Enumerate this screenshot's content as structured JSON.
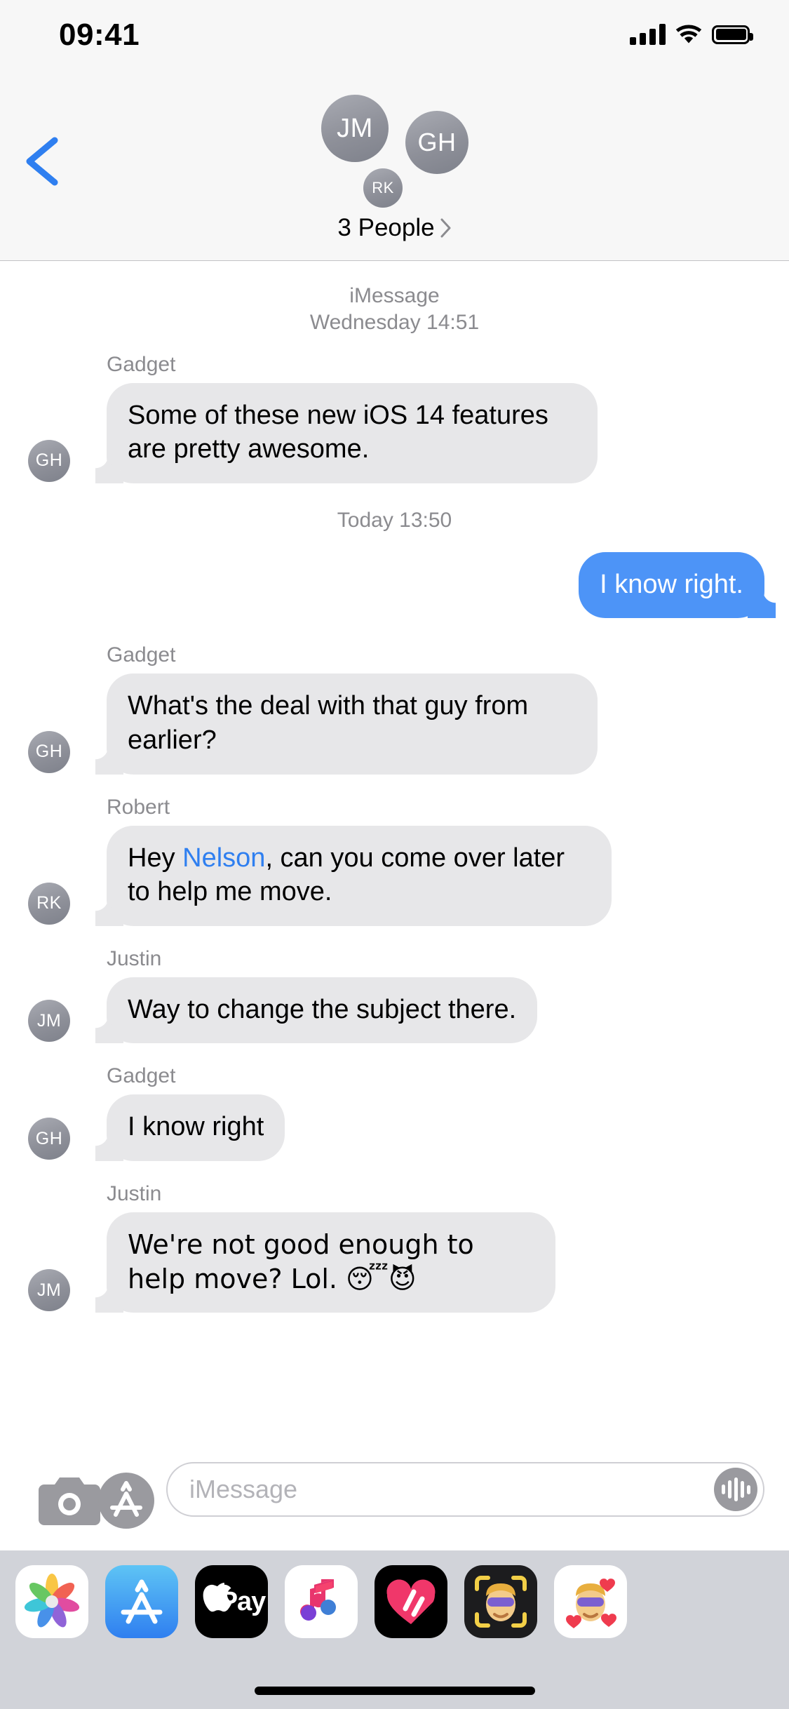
{
  "status_bar": {
    "time": "09:41",
    "cellular_icon": "cellular-bars-icon",
    "wifi_icon": "wifi-icon",
    "battery_icon": "battery-full-icon"
  },
  "nav": {
    "back_icon": "chevron-left-icon",
    "participants_label": "3 People",
    "disclosure_icon": "chevron-right-icon",
    "avatars": [
      {
        "initials": "JM",
        "name": "Justin"
      },
      {
        "initials": "GH",
        "name": "Gadget"
      },
      {
        "initials": "RK",
        "name": "Robert"
      }
    ]
  },
  "thread": {
    "dividers": {
      "first": {
        "service": "iMessage",
        "timestamp": "Wednesday 14:51"
      },
      "second": {
        "service": "",
        "timestamp": "Today 13:50"
      }
    },
    "messages": [
      {
        "sender": "Gadget",
        "initials": "GH",
        "direction": "incoming",
        "text": "Some of these new iOS 14 features are pretty awesome."
      },
      {
        "sender": "",
        "initials": "",
        "direction": "outgoing",
        "text": "I know right."
      },
      {
        "sender": "Gadget",
        "initials": "GH",
        "direction": "incoming",
        "text": "What's the deal with that guy from earlier?"
      },
      {
        "sender": "Robert",
        "initials": "RK",
        "direction": "incoming",
        "text_before_mention": "Hey ",
        "mention": "Nelson",
        "text_after_mention": ", can you come over later to help me move.",
        "text": "Hey Nelson, can you come over later to help me move."
      },
      {
        "sender": "Justin",
        "initials": "JM",
        "direction": "incoming",
        "text": "Way to change the subject there."
      },
      {
        "sender": "Gadget",
        "initials": "GH",
        "direction": "incoming",
        "text": "I know right"
      },
      {
        "sender": "Justin",
        "initials": "JM",
        "direction": "incoming",
        "text": "We're not good enough to help move? Lol. 😴😈"
      }
    ]
  },
  "input_bar": {
    "camera_icon": "camera-icon",
    "appstore_icon": "app-store-icon",
    "placeholder": "iMessage",
    "audio_icon": "audio-waveform-icon"
  },
  "app_drawer": {
    "apps": [
      {
        "name": "Photos",
        "icon": "photos-icon"
      },
      {
        "name": "App Store",
        "icon": "app-store-icon"
      },
      {
        "name": "Apple Pay",
        "icon": "apple-pay-icon",
        "label": "Pay"
      },
      {
        "name": "Music",
        "icon": "music-note-icon"
      },
      {
        "name": "Digital Touch",
        "icon": "digital-touch-heart-icon"
      },
      {
        "name": "Memoji Camera",
        "icon": "memoji-camera-icon"
      },
      {
        "name": "Memoji Stickers",
        "icon": "memoji-stickers-icon"
      }
    ]
  },
  "colors": {
    "outgoing_bubble": "#4d94f7",
    "incoming_bubble": "#e7e7e9",
    "mention_blue": "#2f7ff0",
    "header_bg": "#f7f7f7",
    "drawer_bg": "#d1d3d9",
    "secondary_text": "#8b8b8f"
  }
}
